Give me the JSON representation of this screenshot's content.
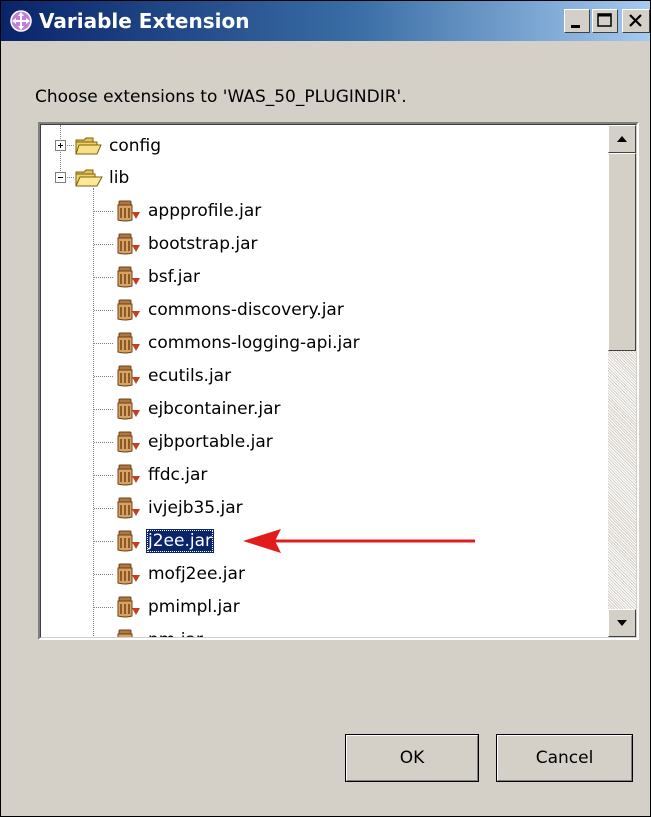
{
  "window": {
    "title": "Variable Extension",
    "controls": {
      "minimize": "minimize",
      "maximize": "maximize",
      "close": "close"
    }
  },
  "prompt": "Choose extensions to 'WAS_50_PLUGINDIR'.",
  "tree": {
    "folders": [
      {
        "label": "config",
        "expanded": false,
        "icon": "folder-icon"
      },
      {
        "label": "lib",
        "expanded": true,
        "icon": "open-folder-icon"
      }
    ],
    "lib_children": [
      {
        "label": "appprofile.jar",
        "icon": "jar-icon"
      },
      {
        "label": "bootstrap.jar",
        "icon": "jar-icon"
      },
      {
        "label": "bsf.jar",
        "icon": "jar-icon"
      },
      {
        "label": "commons-discovery.jar",
        "icon": "jar-icon"
      },
      {
        "label": "commons-logging-api.jar",
        "icon": "jar-icon"
      },
      {
        "label": "ecutils.jar",
        "icon": "jar-icon"
      },
      {
        "label": "ejbcontainer.jar",
        "icon": "jar-icon"
      },
      {
        "label": "ejbportable.jar",
        "icon": "jar-icon"
      },
      {
        "label": "ffdc.jar",
        "icon": "jar-icon"
      },
      {
        "label": "ivjejb35.jar",
        "icon": "jar-icon"
      },
      {
        "label": "j2ee.jar",
        "icon": "jar-icon",
        "selected": true
      },
      {
        "label": "mofj2ee.jar",
        "icon": "jar-icon"
      },
      {
        "label": "pmimpl.jar",
        "icon": "jar-icon"
      },
      {
        "label": "pm.jar",
        "icon": "jar-icon"
      }
    ],
    "scroll_position": 0.0
  },
  "annotation": {
    "color": "#e41b1b",
    "points_to": "j2ee.jar"
  },
  "buttons": {
    "ok": "OK",
    "cancel": "Cancel"
  },
  "colors": {
    "title_start": "#0a246a",
    "title_end": "#a6caf0",
    "selection": "#0a246a",
    "face": "#d4d0c8"
  }
}
